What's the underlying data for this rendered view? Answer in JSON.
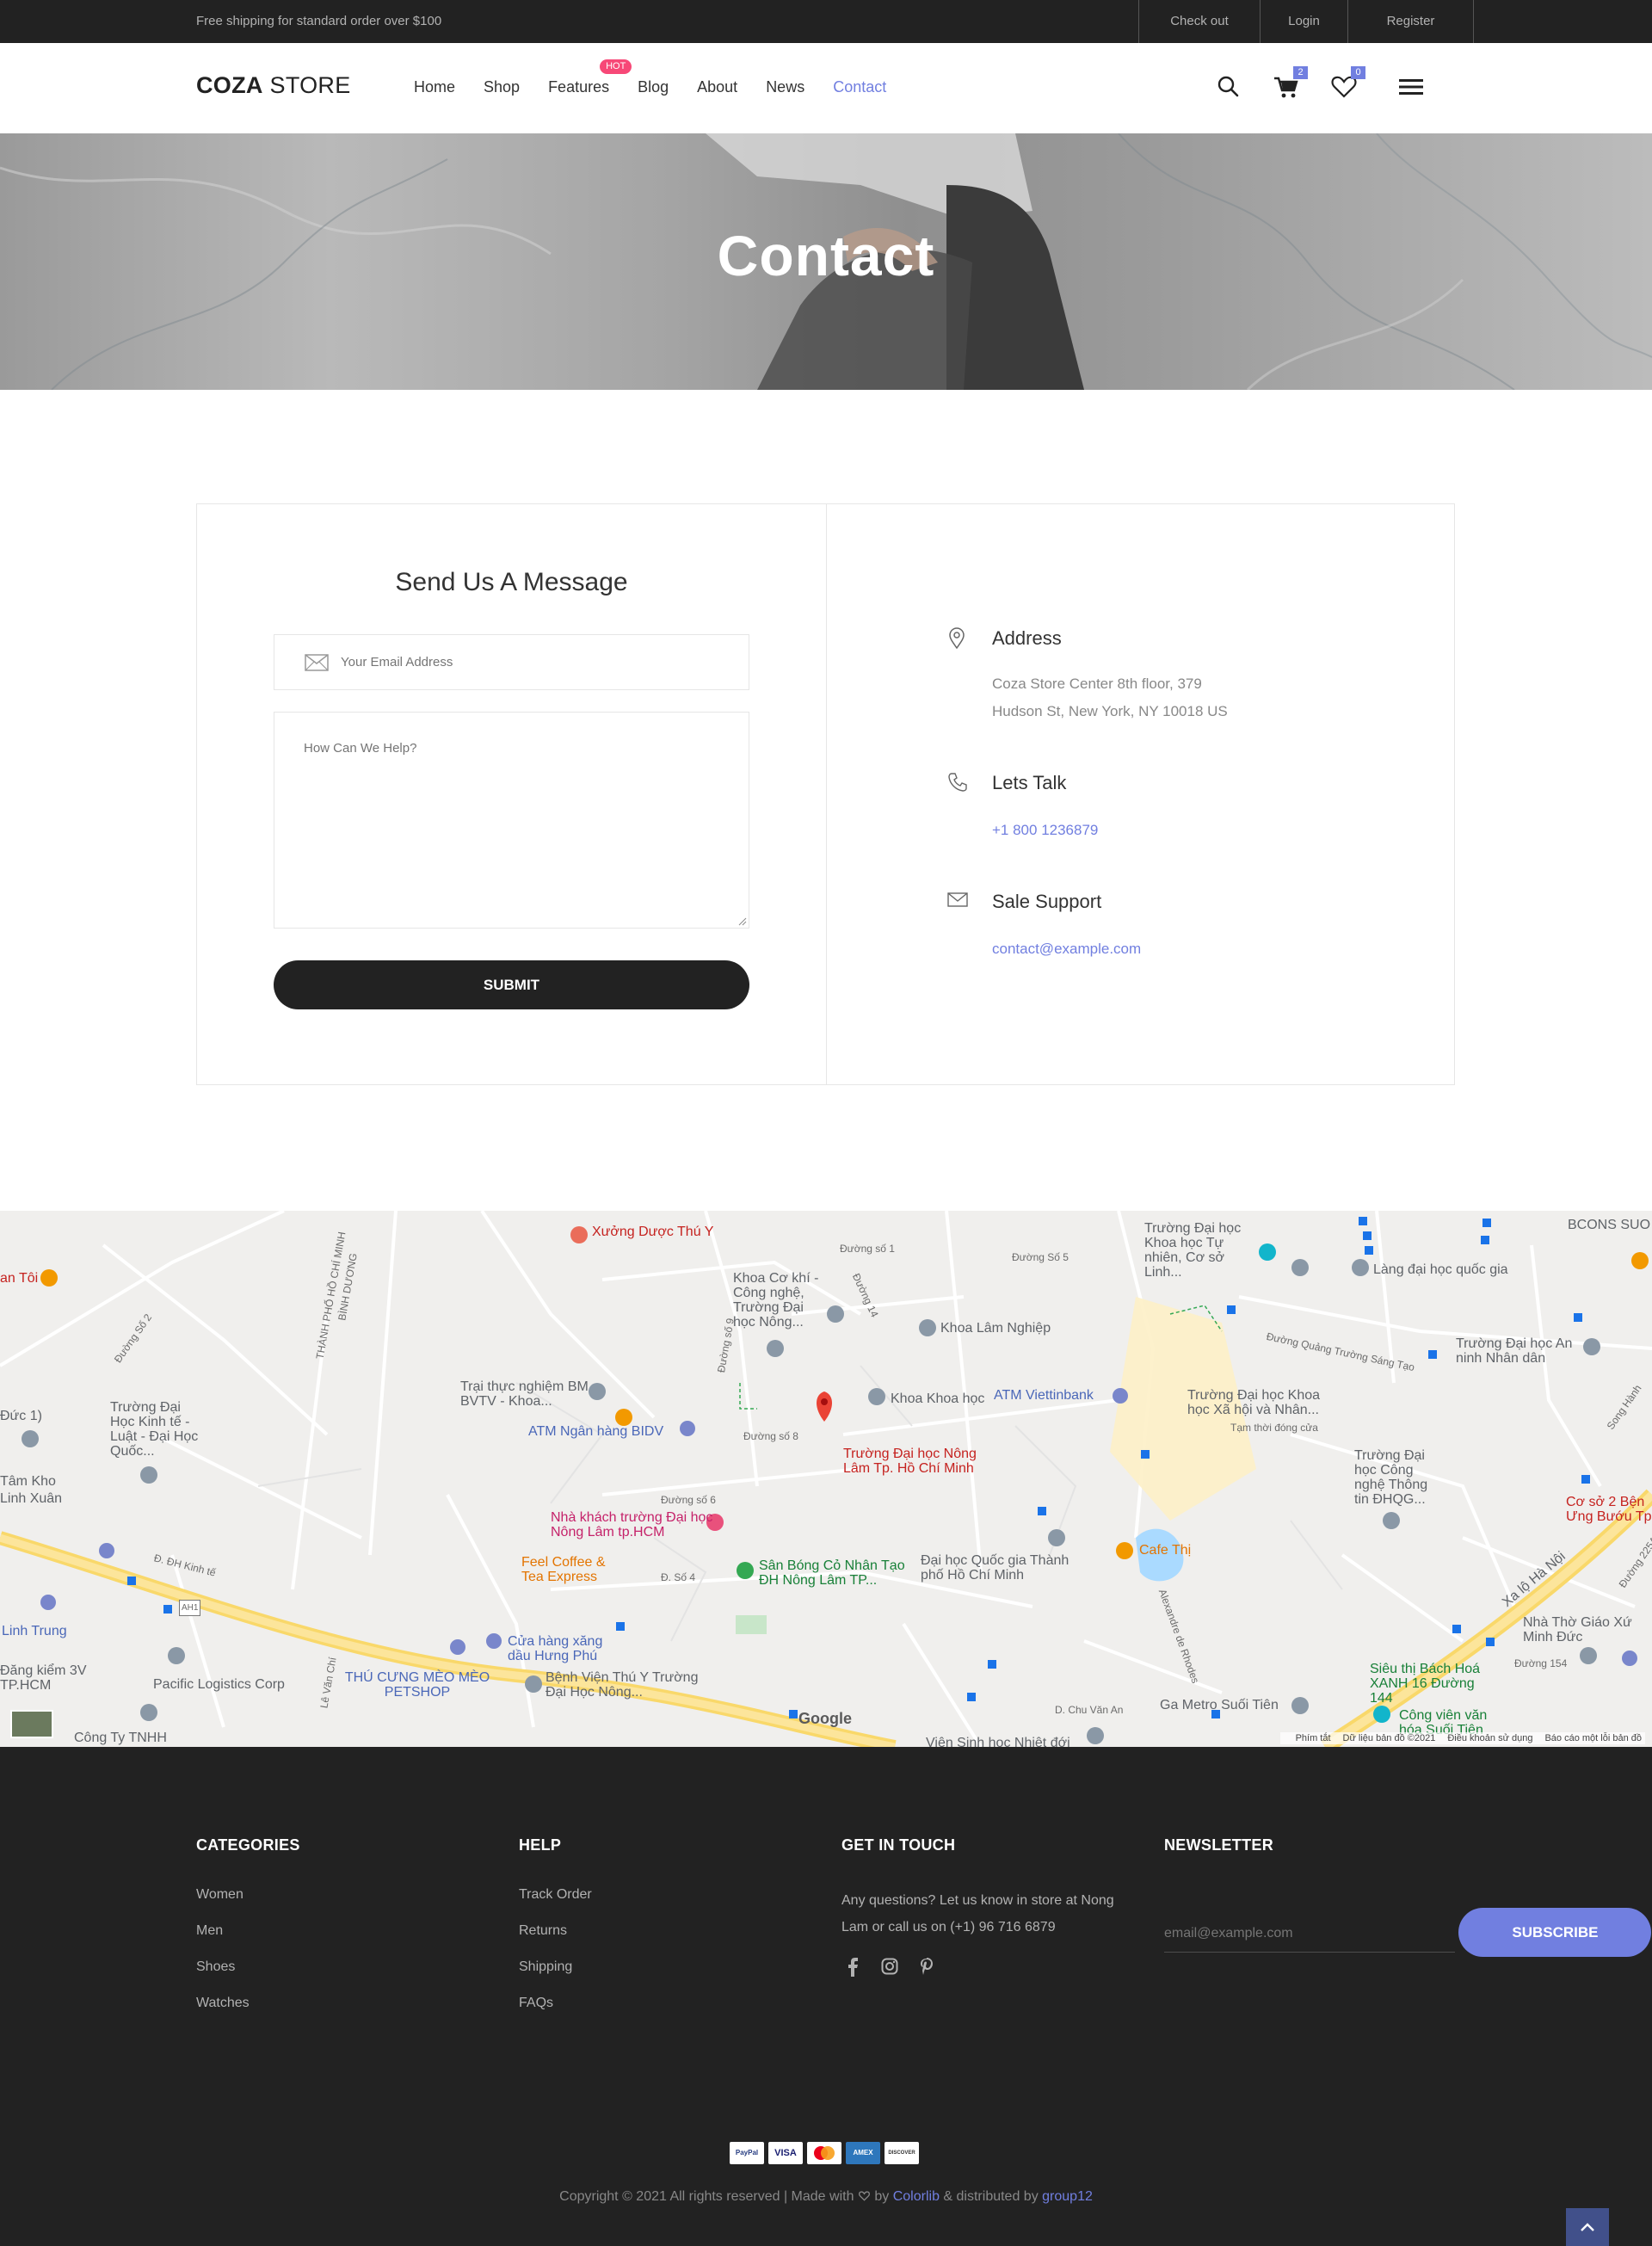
{
  "topbar": {
    "shipping_text": "Free shipping for standard order over $100",
    "links": [
      "Check out",
      "Login",
      "Register"
    ]
  },
  "header": {
    "logo_bold": "COZA",
    "logo_light": " STORE",
    "nav": [
      {
        "label": "Home"
      },
      {
        "label": "Shop"
      },
      {
        "label": "Features",
        "badge": "HOT"
      },
      {
        "label": "Blog"
      },
      {
        "label": "About"
      },
      {
        "label": "News"
      },
      {
        "label": "Contact",
        "active": true
      }
    ],
    "cart_count": "2",
    "wishlist_count": "0",
    "icons": [
      "search-icon",
      "cart-icon",
      "heart-icon",
      "hamburger-menu-icon"
    ]
  },
  "hero": {
    "title": "Contact"
  },
  "form": {
    "title": "Send Us A Message",
    "email_placeholder": "Your Email Address",
    "message_placeholder": "How Can We Help?",
    "submit_label": "SUBMIT"
  },
  "contact_info": {
    "address": {
      "title": "Address",
      "line1": "Coza Store Center 8th floor, 379",
      "line2": "Hudson St, New York, NY 10018 US"
    },
    "talk": {
      "title": "Lets Talk",
      "phone": "+1 800 1236879"
    },
    "support": {
      "title": "Sale Support",
      "email": "contact@example.com"
    }
  },
  "map": {
    "labels": {
      "l1": "Xưởng Dược Thú Y",
      "l2": "Trường Đại học Khoa học Tự nhiên, Cơ sở Linh...",
      "l3": "Làng đại học quốc gia",
      "l4": "BCONS SUO",
      "l5": "Khoa Cơ khí - Công nghệ, Trường Đại học Nông...",
      "l6": "Khoa Lâm Nghiệp",
      "l7": "Trường Đại học An ninh Nhân dân",
      "l8": "Trại thực nghiệm BM BVTV - Khoa...",
      "l9": "Khoa Khoa học",
      "l10": "ATM Viettinbank",
      "l11": "Trường Đại học Khoa học Xã hội và Nhân...",
      "l11b": "Tạm thời đóng cửa",
      "l12": "Trường Đại Học Kinh tế - Luật - Đại Học Quốc...",
      "l13": "ATM Ngân hàng BIDV",
      "l14": "Trường Đại học Nông Lâm Tp. Hồ Chí Minh",
      "l15": "Trường Đại học Công nghệ Thông tin ĐHQG...",
      "l16": "Cơ sở 2 Bện Ưng Bướu Tp",
      "l17": "Nhà khách trường Đại học Nông Lâm tp.HCM",
      "l18": "Feel Coffee & Tea Express",
      "l19": "Sân Bóng Cỏ Nhân Tạo ĐH Nông Lâm TP...",
      "l20": "Đại học Quốc gia Thành phố Hồ Chí Minh",
      "l21": "Cafe Thị",
      "l22": "Xa lộ Hà Nội",
      "l23": "Linh Trung",
      "l24": "Nhà Thờ Giáo Xứ Minh Đức",
      "l25": "Cửa hàng xăng dầu Hưng Phú",
      "l26": "Đăng kiểm 3V TP.HCM",
      "l27": "Pacific Logistics Corp",
      "l28": "THÚ CƯNG MÈO MÈO PETSHOP",
      "l29": "Bệnh Viện Thú Y Trường Đại Học Nông...",
      "l30": "Siêu thị Bách Hoá XANH 16 Đường 144",
      "l31": "Ga Metro Suối Tiên",
      "l32": "Công viên văn hóa Suối Tiên",
      "l33": "Công Ty TNHH",
      "l34": "Viện Sinh học Nhiệt đới",
      "l35": "Linh Xuân",
      "l36": "Tâm Kho",
      "l37": "Đức 1)",
      "l38": "an Tôi"
    },
    "streets": {
      "s1": "Đường Số 2",
      "s2": "THÀNH PHỐ HỒ CHÍ MINH",
      "s3": "BÌNH DƯƠNG",
      "s4": "Đường số 8",
      "s5": "Đường số 6",
      "s6": "Đường 14",
      "s7": "Đường Số 5",
      "s8": "Đường số 9",
      "s9": "Đ. Số 4",
      "s10": "Đường Quảng Trường Sáng Tạo",
      "s11": "Song Hành",
      "s12": "Đường 154",
      "s13": "D. Chu Văn An",
      "s14": "Đ. ĐH Kinh tế",
      "s15": "AH1",
      "s16": "Lê Văn Chí",
      "s17": "Alexandre de Rhodes",
      "s18": "Đường 225A",
      "s19": "Đường số 1"
    },
    "google_logo": "Google",
    "attribution": [
      "Phím tắt",
      "Dữ liệu bản đồ ©2021",
      "Điều khoản sử dụng",
      "Báo cáo một lỗi bản đồ"
    ]
  },
  "footer": {
    "categories": {
      "title": "CATEGORIES",
      "items": [
        "Women",
        "Men",
        "Shoes",
        "Watches"
      ]
    },
    "help": {
      "title": "HELP",
      "items": [
        "Track Order",
        "Returns",
        "Shipping",
        "FAQs"
      ]
    },
    "touch": {
      "title": "GET IN TOUCH",
      "text": "Any questions? Let us know in store at Nong Lam or call us on (+1) 96 716 6879",
      "social": [
        "facebook-icon",
        "instagram-icon",
        "pinterest-icon"
      ]
    },
    "newsletter": {
      "title": "NEWSLETTER",
      "placeholder": "email@example.com",
      "button": "SUBSCRIBE"
    },
    "payments": [
      "PayPal",
      "VISA",
      "MC",
      "AMEX",
      "DISCOVER"
    ],
    "copyright_pre": "Copyright © 2021 All rights reserved | Made with ",
    "copyright_by": " by ",
    "colorlib": "Colorlib",
    "distributed": " & distributed by ",
    "group": "group12"
  }
}
